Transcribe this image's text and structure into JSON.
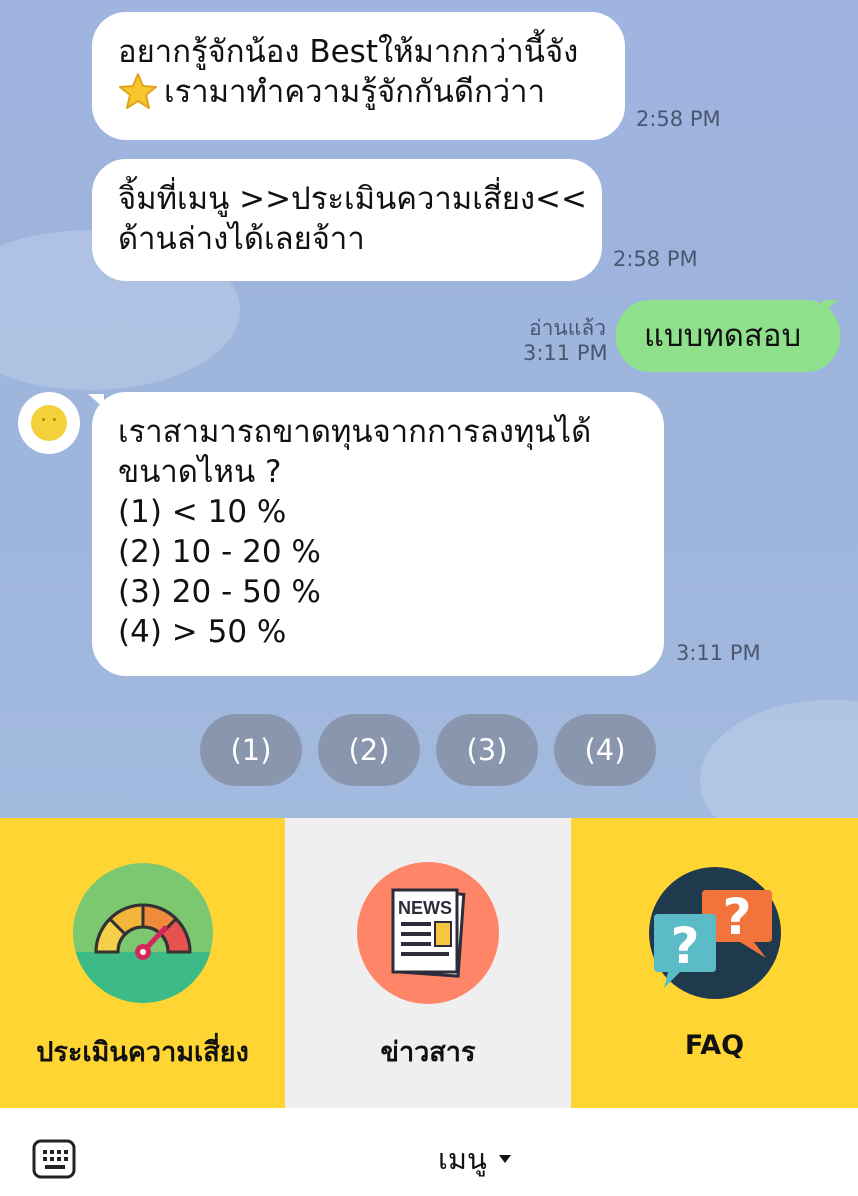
{
  "messages": [
    {
      "lines": [
        "อยากรู้จักน้อง Bestให้มากกว่านี้จัง",
        "เรามาทำความรู้จักกันดีกว่าา"
      ],
      "time": "2:58 PM",
      "emoji": "star-icon"
    },
    {
      "lines": [
        "จิ้มที่เมนู >>ประเมินความเสี่ยง<<",
        "ด้านล่างได้เลยจ้าา"
      ],
      "time": "2:58 PM"
    },
    {
      "lines": [
        "แบบทดสอบ"
      ],
      "time": "3:11 PM",
      "read": "อ่านแล้ว",
      "outgoing": true
    },
    {
      "lines": [
        "เราสามารถขาดทุนจากการลงทุนได้",
        "ขนาดไหน ?",
        "(1) < 10 %",
        "(2) 10 - 20 %",
        "(3) 20 - 50 %",
        "(4) > 50 %"
      ],
      "time": "3:11 PM"
    }
  ],
  "quick_replies": [
    "(1)",
    "(2)",
    "(3)",
    "(4)"
  ],
  "rich_menu": [
    {
      "label": "ประเมินความเสี่ยง",
      "icon": "gauge-icon",
      "bg": "#ffd533"
    },
    {
      "label": "ข่าวสาร",
      "icon": "news-icon",
      "bg": "#efefef",
      "icon_text": "NEWS"
    },
    {
      "label": "FAQ",
      "icon": "question-icon",
      "bg": "#ffd533",
      "icon_text": "?"
    }
  ],
  "bottom_bar": {
    "menu_label": "เมนู",
    "keyboard_icon": "keyboard-icon"
  },
  "colors": {
    "chat_bg": "#9fb4de",
    "outgoing_bubble": "#8fe08a",
    "incoming_bubble": "#ffffff",
    "quick_reply": "#8a96ad",
    "menu_yellow": "#ffd533"
  }
}
